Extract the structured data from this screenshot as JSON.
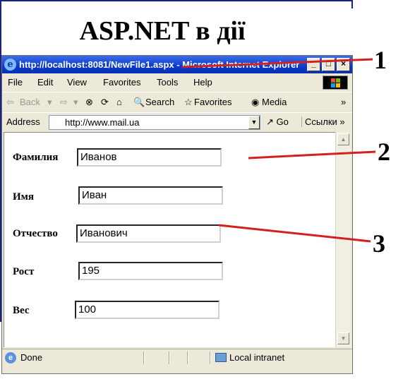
{
  "slide": {
    "title": "ASP.NET в дії"
  },
  "browser": {
    "title": "http://localhost:8081/NewFile1.aspx - Microsoft Internet Explorer",
    "menu": [
      "File",
      "Edit",
      "View",
      "Favorites",
      "Tools",
      "Help"
    ],
    "toolbar": {
      "back": "Back",
      "search": "Search",
      "favorites": "Favorites",
      "media": "Media"
    },
    "address": {
      "label": "Address",
      "url": "http://www.mail.ua",
      "go": "Go",
      "links": "Ссылки"
    },
    "status": {
      "text": "Done",
      "zone": "Local intranet"
    }
  },
  "form": {
    "fields": [
      {
        "label": "Фамилия",
        "value": "Иванов"
      },
      {
        "label": "Имя",
        "value": "Иван"
      },
      {
        "label": "Отчество",
        "value": "Иванович"
      },
      {
        "label": "Рост",
        "value": "195"
      },
      {
        "label": "Вес",
        "value": "100"
      }
    ]
  },
  "callouts": [
    "1",
    "2",
    "3"
  ],
  "colors": {
    "callout_line": "#d32020",
    "titlebar": "#0a3ad0",
    "frame": "#1a237e"
  },
  "icons": [
    "ie-logo-icon",
    "back-arrow-icon",
    "forward-arrow-icon",
    "stop-icon",
    "refresh-icon",
    "home-icon",
    "search-icon",
    "favorites-icon",
    "media-icon",
    "go-icon",
    "windows-logo-icon",
    "page-done-icon",
    "local-intranet-icon"
  ]
}
